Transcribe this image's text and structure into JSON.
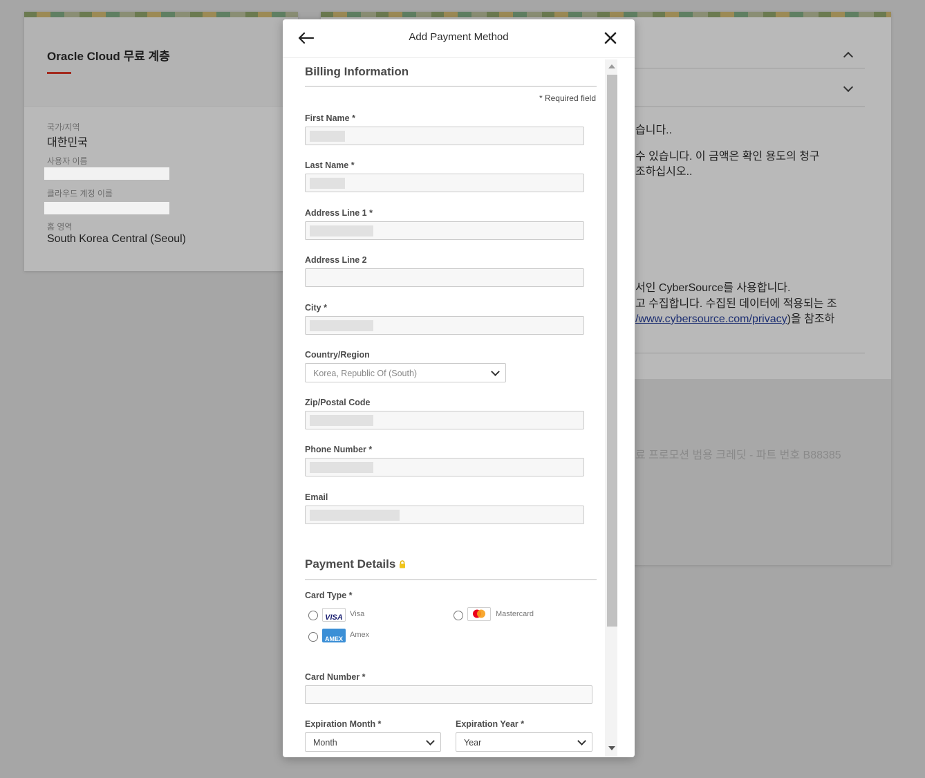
{
  "background": {
    "account_card": {
      "title": "Oracle Cloud 무료 계층",
      "country_label": "국가/지역",
      "country_value": "대한민국",
      "username_label": "사용자 이름",
      "cloud_account_label": "클라우드 계정 이름",
      "home_region_label": "홈 영역",
      "home_region_value": "South Korea Central (Seoul)"
    },
    "right_card": {
      "line1": "습니다..",
      "line2": "수 있습니다. 이 금액은 확인 용도의 청구",
      "line3": "조하십시오..",
      "line4": "서인 CyberSource를 사용합니다.",
      "line5": "고 수집합니다. 수집된 데이터에 적용되는 조",
      "line6_link": "/www.cybersource.com/privacy",
      "line6_suffix": ")을 참조하",
      "line7": "료 프로모션 범용 크레딧 - 파트 번호 B88385"
    }
  },
  "modal": {
    "title": "Add Payment Method",
    "back_icon": "arrow-left-icon",
    "close_icon": "close-icon",
    "billing_title": "Billing Information",
    "required_note": "* Required field",
    "fields": {
      "first_name": "First Name *",
      "last_name": "Last Name *",
      "address1": "Address Line 1 *",
      "address2": "Address Line 2",
      "city": "City *",
      "country": "Country/Region",
      "zip": "Zip/Postal Code",
      "phone": "Phone Number *",
      "email": "Email"
    },
    "country_value": "Korea, Republic Of (South)",
    "payment_title": "Payment Details",
    "lock_icon": "lock-icon",
    "card_type_label": "Card Type *",
    "card_types": {
      "visa": "Visa",
      "visa_logo": "VISA",
      "mastercard": "Mastercard",
      "amex": "Amex",
      "amex_logo": "AMEX"
    },
    "card_number_label": "Card Number *",
    "exp_month_label": "Expiration Month *",
    "exp_month_value": "Month",
    "exp_year_label": "Expiration Year *",
    "exp_year_value": "Year"
  }
}
